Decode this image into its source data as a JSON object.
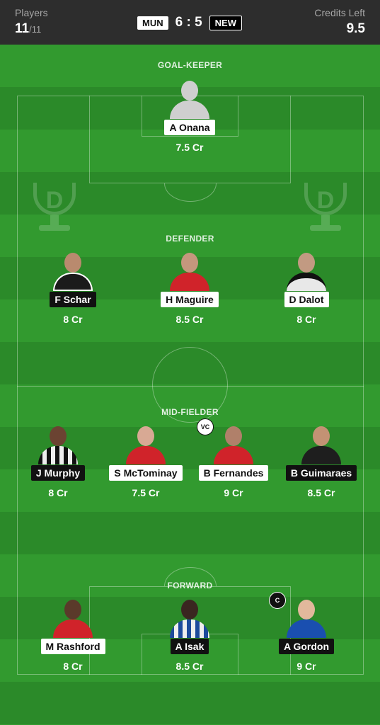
{
  "header": {
    "players_label": "Players",
    "players_count": "11",
    "players_max": "/11",
    "credits_label": "Credits Left",
    "credits_value": "9.5"
  },
  "match": {
    "home": "MUN",
    "home_score": "6",
    "separator": ":",
    "away_score": "5",
    "away": "NEW"
  },
  "sections": {
    "goalkeeper": "GOAL-KEEPER",
    "defender": "DEFENDER",
    "midfielder": "MID-FIELDER",
    "forward": "FORWARD"
  },
  "players": {
    "gk": [
      {
        "name": "A Onana",
        "credit": "7.5 Cr",
        "team": "MUN"
      }
    ],
    "def": [
      {
        "name": "F Schar",
        "credit": "8 Cr",
        "team": "NEW"
      },
      {
        "name": "H Maguire",
        "credit": "8.5 Cr",
        "team": "MUN"
      },
      {
        "name": "D Dalot",
        "credit": "8 Cr",
        "team": "NEW"
      }
    ],
    "mid": [
      {
        "name": "J Murphy",
        "credit": "8 Cr",
        "team": "NEW"
      },
      {
        "name": "S McTominay",
        "credit": "7.5 Cr",
        "team": "MUN"
      },
      {
        "name": "B Fernandes",
        "credit": "9 Cr",
        "team": "MUN",
        "badge": "VC"
      },
      {
        "name": "B Guimaraes",
        "credit": "8.5 Cr",
        "team": "NEW"
      }
    ],
    "fwd": [
      {
        "name": "M Rashford",
        "credit": "8 Cr",
        "team": "MUN"
      },
      {
        "name": "A Isak",
        "credit": "8.5 Cr",
        "team": "NEW"
      },
      {
        "name": "A Gordon",
        "credit": "9 Cr",
        "team": "NEW",
        "badge": "C"
      }
    ]
  },
  "logo_letter": "D",
  "colors": {
    "header_bg": "#2d2d2d",
    "pitch_green": "#329a2f",
    "mun_kit": "#d0232a",
    "new_kit": "#1b1b1b"
  }
}
